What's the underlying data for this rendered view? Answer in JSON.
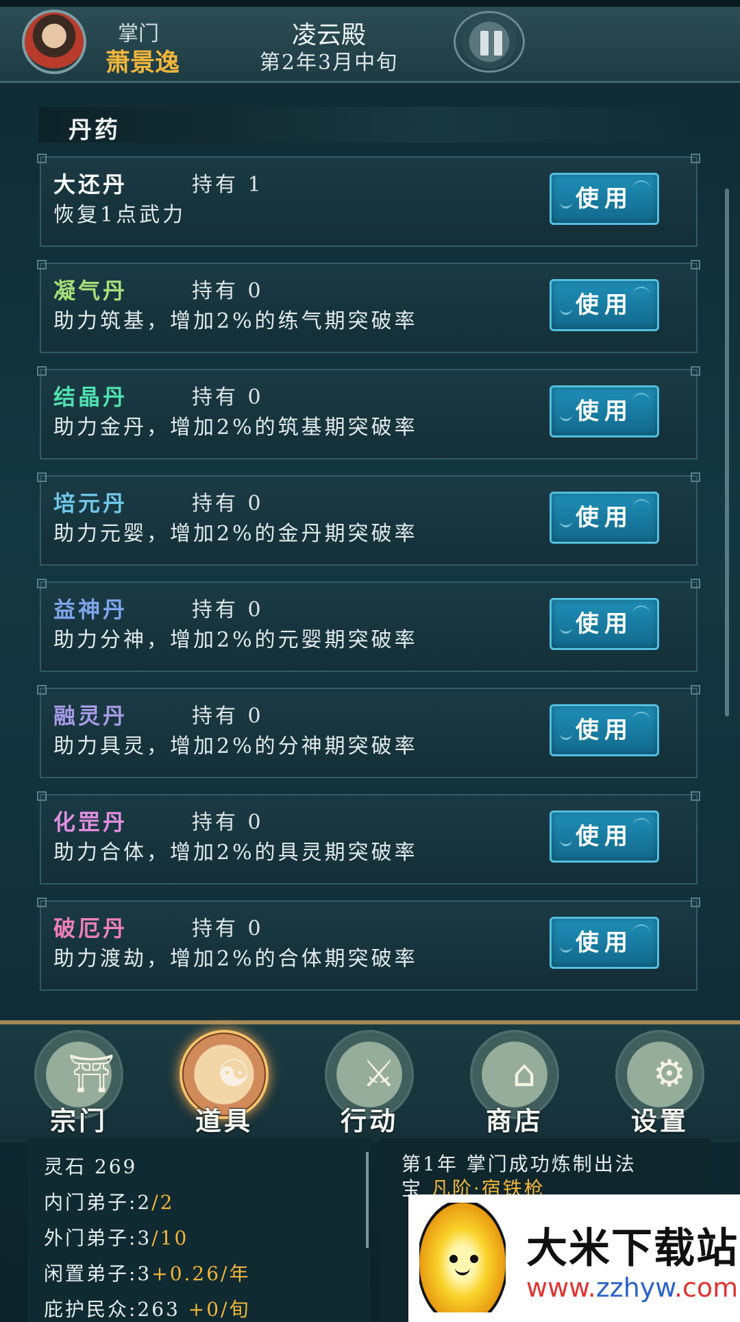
{
  "header": {
    "role_label": "掌门",
    "leader_name": "萧景逸",
    "sect_name": "凌云殿",
    "game_date": "第2年3月中旬"
  },
  "section": {
    "title": "丹药"
  },
  "items": [
    {
      "name": "大还丹",
      "held": "持有 1",
      "desc": "恢复1点武力",
      "color": "#ffffff"
    },
    {
      "name": "凝气丹",
      "held": "持有 0",
      "desc": "助力筑基，增加2%的练气期突破率",
      "color": "#a7e07a"
    },
    {
      "name": "结晶丹",
      "held": "持有 0",
      "desc": "助力金丹，增加2%的筑基期突破率",
      "color": "#4fe0b0"
    },
    {
      "name": "培元丹",
      "held": "持有 0",
      "desc": "助力元婴，增加2%的金丹期突破率",
      "color": "#6fc6e8"
    },
    {
      "name": "益神丹",
      "held": "持有 0",
      "desc": "助力分神，增加2%的元婴期突破率",
      "color": "#7ea4ec"
    },
    {
      "name": "融灵丹",
      "held": "持有 0",
      "desc": "助力具灵，增加2%的分神期突破率",
      "color": "#a69ae6"
    },
    {
      "name": "化罡丹",
      "held": "持有 0",
      "desc": "助力合体，增加2%的具灵期突破率",
      "color": "#e08ee0"
    },
    {
      "name": "破厄丹",
      "held": "持有 0",
      "desc": "助力渡劫，增加2%的合体期突破率",
      "color": "#f080b8"
    }
  ],
  "use_label": "使用",
  "nav": [
    {
      "label": "宗门",
      "icon": "sect-gate-icon"
    },
    {
      "label": "道具",
      "icon": "item-bag-icon"
    },
    {
      "label": "行动",
      "icon": "action-sword-icon"
    },
    {
      "label": "商店",
      "icon": "shop-icon"
    },
    {
      "label": "设置",
      "icon": "gear-icon"
    }
  ],
  "stats": {
    "spirit_stone": "灵石 269",
    "inner_label": "内门弟子:2",
    "inner_max": "/2",
    "outer_label": "外门弟子:3",
    "outer_max": "/10",
    "idle_label": "闲置弟子:3",
    "idle_rate": "+0.26/年",
    "people_label": "庇护民众:263",
    "people_rate": "+0/旬"
  },
  "log": {
    "line1": "第1年  掌门成功炼制出法",
    "line2_prefix": "宝 ",
    "line2_item": "凡阶·宿铁枪"
  },
  "watermark": {
    "title": "大米下载站",
    "url_prefix": "www.",
    "url_mid": "zzhyw",
    "url_suffix": ".com"
  }
}
